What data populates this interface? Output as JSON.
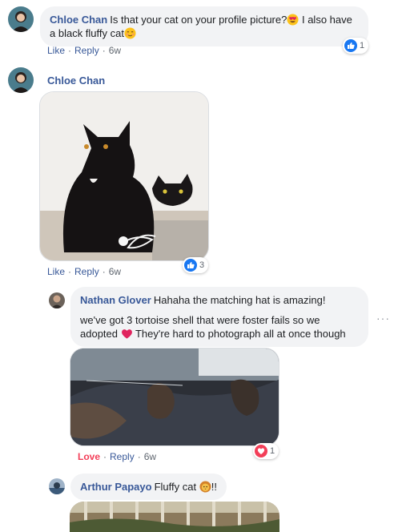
{
  "comments": [
    {
      "author": "Chloe Chan",
      "text_part1": "Is that your cat on your profile picture?",
      "text_part2": " I also have a black fluffy cat",
      "like_label": "Like",
      "reply_label": "Reply",
      "time": "6w",
      "reaction_count": "1"
    },
    {
      "author": "Chloe Chan",
      "like_label": "Like",
      "reply_label": "Reply",
      "time": "6w",
      "reaction_count": "3"
    }
  ],
  "replies": [
    {
      "author": "Nathan Glover",
      "text_line1": "Hahaha the matching hat is amazing!",
      "text_line2a": "we've got 3 tortoise shell that were foster fails so we adopted ",
      "text_line2b": " They're hard to photograph all at once though",
      "reaction_label": "Love",
      "reply_label": "Reply",
      "time": "6w",
      "reaction_count": "1"
    },
    {
      "author": "Arthur Papayo",
      "text": "Fluffy cat ",
      "text_suffix": "!!"
    }
  ],
  "separator": "·",
  "more_options": "···",
  "colors": {
    "link": "#385898",
    "like_blue": "#1877f2",
    "love_red": "#f33e58"
  },
  "icons": [
    "like-icon",
    "love-icon",
    "heart-eyes-emoji",
    "blushing-emoji",
    "heart-emoji",
    "lion-emoji",
    "more-options-icon"
  ]
}
